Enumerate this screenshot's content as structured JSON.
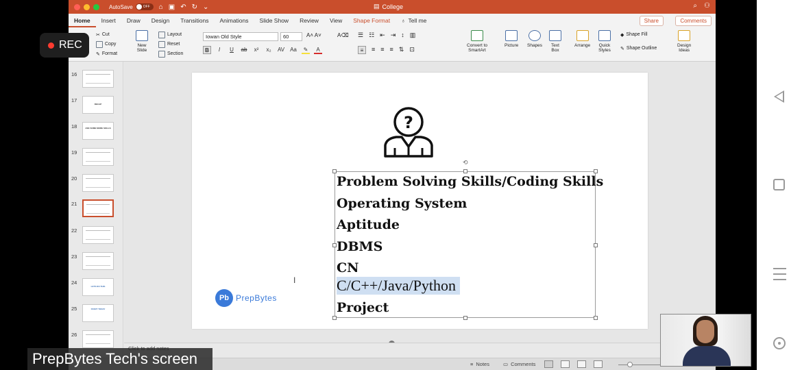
{
  "window": {
    "autosave_label": "AutoSave",
    "autosave_state": "OFF",
    "doc_title": "College"
  },
  "tabs": [
    "Home",
    "Insert",
    "Draw",
    "Design",
    "Transitions",
    "Animations",
    "Slide Show",
    "Review",
    "View",
    "Shape Format"
  ],
  "tell_me": "Tell me",
  "share_label": "Share",
  "comments_label": "Comments",
  "ribbon": {
    "paste": "Paste",
    "cut": "Cut",
    "copy": "Copy",
    "format": "Format",
    "new_slide": "New\nSlide",
    "layout": "Layout",
    "reset": "Reset",
    "section": "Section",
    "font_name": "Iowan Old Style",
    "font_size": "60",
    "convert": "Convert to\nSmartArt",
    "picture": "Picture",
    "shapes": "Shapes",
    "text_box": "Text\nBox",
    "arrange": "Arrange",
    "quick_styles": "Quick\nStyles",
    "shape_fill": "Shape Fill",
    "shape_outline": "Shape Outline",
    "design_ideas": "Design\nIdeas"
  },
  "thumbnails": [
    {
      "num": "16",
      "text": ""
    },
    {
      "num": "17",
      "text": "RECAP"
    },
    {
      "num": "18",
      "text": "ASK SOME MORE SKILLS"
    },
    {
      "num": "19",
      "text": ""
    },
    {
      "num": "20",
      "text": ""
    },
    {
      "num": "21",
      "text": ""
    },
    {
      "num": "22",
      "text": ""
    },
    {
      "num": "23",
      "text": ""
    },
    {
      "num": "24",
      "text": "LETS DO THIS"
    },
    {
      "num": "25",
      "text": "START TODAY"
    },
    {
      "num": "26",
      "text": ""
    }
  ],
  "slide": {
    "lines": [
      "Problem Solving Skills/Coding Skills",
      "Operating System",
      "Aptitude",
      "DBMS",
      "CN",
      "C/C++/Java/Python",
      "Project"
    ],
    "logo_mark": "Pb",
    "logo_text": "PrepBytes"
  },
  "notes_placeholder": "Click to add notes",
  "status": {
    "notes": "Notes",
    "comments": "Comments"
  },
  "rec_label": "REC",
  "screen_label": "PrepBytes Tech's screen"
}
